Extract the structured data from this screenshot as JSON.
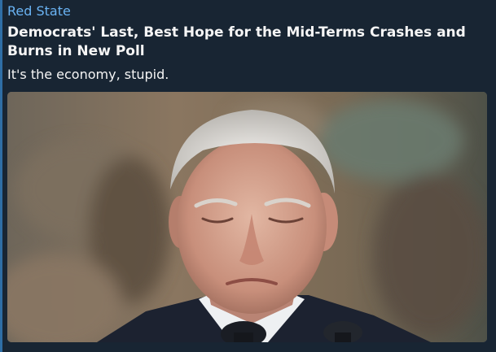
{
  "preview": {
    "site_name": "Red State",
    "title": "Democrats' Last, Best Hope for the Mid-Terms Crashes and Burns in New Poll",
    "description": "It's the economy, stupid."
  },
  "image": {
    "subject": "elderly man with white hair looking down, dark suit, microphones in foreground"
  },
  "colors": {
    "background": "#182533",
    "accent_bar": "#2f6ea5",
    "site_name": "#6ab3f3",
    "text": "#f5f5f5"
  }
}
